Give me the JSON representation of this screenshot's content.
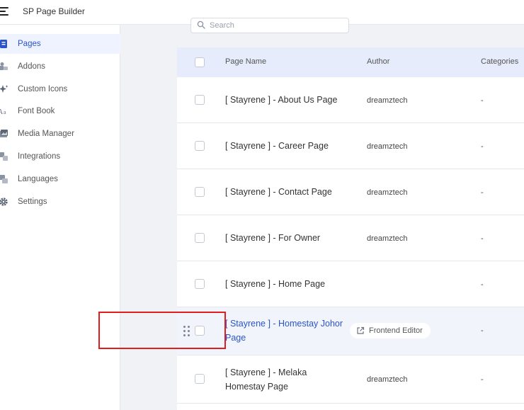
{
  "header": {
    "app_title": "SP Page Builder"
  },
  "sidebar": {
    "items": [
      {
        "label": "Pages",
        "icon": "pages-icon",
        "active": true
      },
      {
        "label": "Addons",
        "icon": "addons-icon"
      },
      {
        "label": "Custom Icons",
        "icon": "sparkle-icon"
      },
      {
        "label": "Font Book",
        "icon": "font-icon"
      },
      {
        "label": "Media Manager",
        "icon": "media-icon"
      },
      {
        "label": "Integrations",
        "icon": "integrations-icon"
      },
      {
        "label": "Languages",
        "icon": "languages-icon"
      },
      {
        "label": "Settings",
        "icon": "gear-icon"
      }
    ]
  },
  "search": {
    "placeholder": "Search"
  },
  "table": {
    "columns": {
      "name": "Page Name",
      "author": "Author",
      "categories": "Categories"
    },
    "rows": [
      {
        "name": "[ Stayrene ] - About Us Page",
        "author": "dreamztech",
        "categories": "-"
      },
      {
        "name": "[ Stayrene ] - Career Page",
        "author": "dreamztech",
        "categories": "-"
      },
      {
        "name": "[ Stayrene ] - Contact Page",
        "author": "dreamztech",
        "categories": "-"
      },
      {
        "name": "[ Stayrene ] - For Owner",
        "author": "dreamztech",
        "categories": "-"
      },
      {
        "name": "[ Stayrene ] - Home Page",
        "author": "",
        "categories": "-"
      },
      {
        "name_line1": "[ Stayrene ] - Homestay Johor",
        "name_line2": "Page",
        "action_label": "Frontend Editor",
        "categories": "-"
      },
      {
        "name_line1": "[ Stayrene ] - Melaka",
        "name_line2": "Homestay Page",
        "author": "dreamztech",
        "categories": "-"
      }
    ]
  },
  "colors": {
    "accent": "#2a55c9",
    "highlight": "#e11d1d",
    "header_bg": "#e6ecfb"
  }
}
